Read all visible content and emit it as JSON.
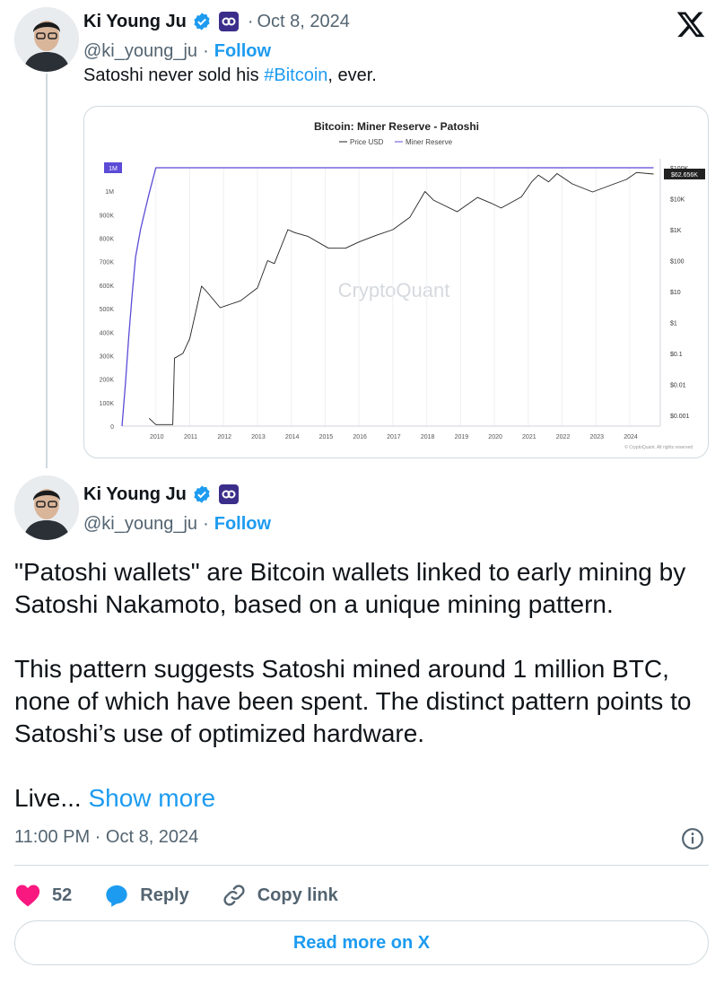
{
  "quoted": {
    "author_name": "Ki Young Ju",
    "handle": "@ki_young_ju",
    "follow_label": "Follow",
    "date": "Oct 8, 2024",
    "text_before": "Satoshi never sold his ",
    "hashtag": "#Bitcoin",
    "text_after": ", ever."
  },
  "main": {
    "author_name": "Ki Young Ju",
    "handle": "@ki_young_ju",
    "follow_label": "Follow",
    "paragraph1": "\"Patoshi wallets\" are Bitcoin wallets linked to early mining by Satoshi Nakamoto, based on a unique mining pattern.",
    "paragraph2": "This pattern suggests Satoshi mined around 1 million BTC, none of which have been spent. The distinct pattern points to Satoshi’s use of optimized hardware.",
    "truncated": "Live...",
    "show_more": "Show more",
    "timestamp": "11:00 PM · Oct 8, 2024"
  },
  "actions": {
    "likes": "52",
    "reply_label": "Reply",
    "copy_link_label": "Copy link"
  },
  "read_more_label": "Read more on X",
  "colors": {
    "accent": "#1d9bf0",
    "like": "#f91880",
    "reserve_line": "#5b4bd6",
    "price_line": "#222222"
  },
  "chart_data": {
    "type": "line",
    "title": "Bitcoin: Miner Reserve - Patoshi",
    "legend": [
      "Price USD",
      "Miner Reserve"
    ],
    "watermark": "CryptoQuant",
    "copyright": "© CryptoQuant. All rights reserved",
    "x_ticks": [
      "2010",
      "2011",
      "2012",
      "2013",
      "2014",
      "2015",
      "2016",
      "2017",
      "2018",
      "2019",
      "2020",
      "2021",
      "2022",
      "2023",
      "2024"
    ],
    "left_axis_ticks": [
      "0",
      "100K",
      "200K",
      "300K",
      "400K",
      "500K",
      "600K",
      "700K",
      "800K",
      "900K",
      "1M",
      "1"
    ],
    "right_axis_ticks": [
      "$0.001",
      "$0.01",
      "$0.1",
      "$1",
      "$10",
      "$100",
      "$1K",
      "$10K",
      "$100K"
    ],
    "left_marker": "1M",
    "right_marker": "$62.656K",
    "series": [
      {
        "name": "Miner Reserve",
        "axis": "left",
        "x": [
          2009.0,
          2009.1,
          2009.2,
          2009.3,
          2009.4,
          2009.55,
          2009.7,
          2009.8,
          2010.0,
          2010.3,
          2024.7
        ],
        "y": [
          0,
          180000,
          380000,
          560000,
          720000,
          840000,
          930000,
          990000,
          1100000,
          1100000,
          1100000
        ]
      },
      {
        "name": "Price USD",
        "axis": "right",
        "x": [
          2009.8,
          2010.0,
          2010.5,
          2010.55,
          2010.8,
          2011.0,
          2011.35,
          2011.5,
          2011.9,
          2012.5,
          2013.0,
          2013.3,
          2013.5,
          2013.9,
          2014.1,
          2014.5,
          2015.1,
          2015.6,
          2016.0,
          2016.5,
          2017.0,
          2017.5,
          2017.95,
          2018.2,
          2018.9,
          2019.5,
          2019.9,
          2020.2,
          2020.8,
          2021.1,
          2021.3,
          2021.6,
          2021.85,
          2022.3,
          2022.9,
          2023.5,
          2023.9,
          2024.2,
          2024.7
        ],
        "y": [
          0.0008,
          0.0005,
          0.0005,
          0.07,
          0.1,
          0.3,
          15,
          10,
          3,
          5,
          13,
          100,
          80,
          1000,
          800,
          600,
          250,
          250,
          400,
          650,
          1000,
          2500,
          17000,
          9000,
          3800,
          11000,
          7200,
          5000,
          11500,
          35000,
          58000,
          35000,
          65000,
          30000,
          16500,
          29000,
          42000,
          70000,
          62656
        ]
      }
    ]
  }
}
